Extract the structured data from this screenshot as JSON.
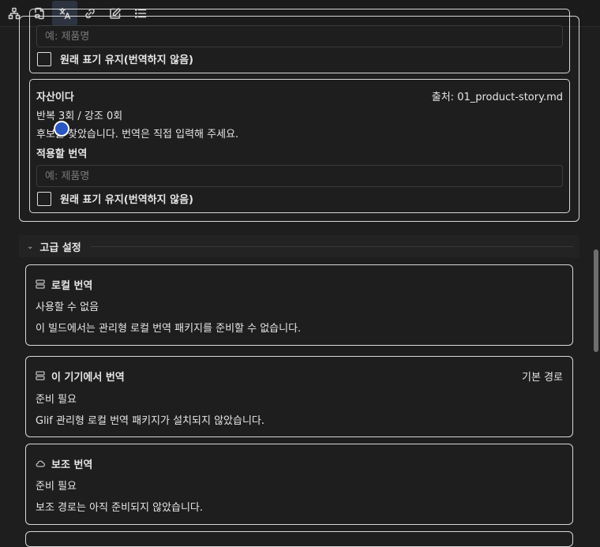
{
  "toolbar": {
    "buttons": [
      {
        "icon": "hierarchy-icon",
        "active": false
      },
      {
        "icon": "file-link-icon",
        "active": false
      },
      {
        "icon": "translate-icon",
        "active": true
      },
      {
        "icon": "link-icon",
        "active": false
      },
      {
        "icon": "edit-icon",
        "active": false
      },
      {
        "icon": "list-icon",
        "active": false
      }
    ]
  },
  "term_cards": [
    {
      "input_placeholder": "예: 제품명",
      "keep_original_label": "원래 표기 유지(번역하지 않음)"
    },
    {
      "term": "자산이다",
      "source": "출처: 01_product-story.md",
      "counts": "반복 3회 / 강조 0회",
      "hint": "후보를 찾았습니다. 번역은 직접 입력해 주세요.",
      "apply_label": "적용할 번역",
      "input_placeholder": "예: 제품명",
      "keep_original_label": "원래 표기 유지(번역하지 않음)"
    }
  ],
  "advanced": {
    "title": "고급 설정",
    "providers": [
      {
        "icon": "server-icon",
        "title": "로컬 번역",
        "badge": "",
        "status": "사용할 수 없음",
        "description": "이 빌드에서는 관리형 로컬 번역 패키지를 준비할 수 없습니다."
      },
      {
        "icon": "server-icon",
        "title": "이 기기에서 번역",
        "badge": "기본 경로",
        "status": "준비 필요",
        "description": "Glif 관리형 로컬 번역 패키지가 설치되지 않았습니다."
      },
      {
        "icon": "cloud-icon",
        "title": "보조 번역",
        "badge": "",
        "status": "준비 필요",
        "description": "보조 경로는 아직 준비되지 않았습니다."
      }
    ]
  },
  "colors": {
    "background": "#1e1e1e",
    "border": "#d8d8d8",
    "accent": "#2a56c6"
  }
}
